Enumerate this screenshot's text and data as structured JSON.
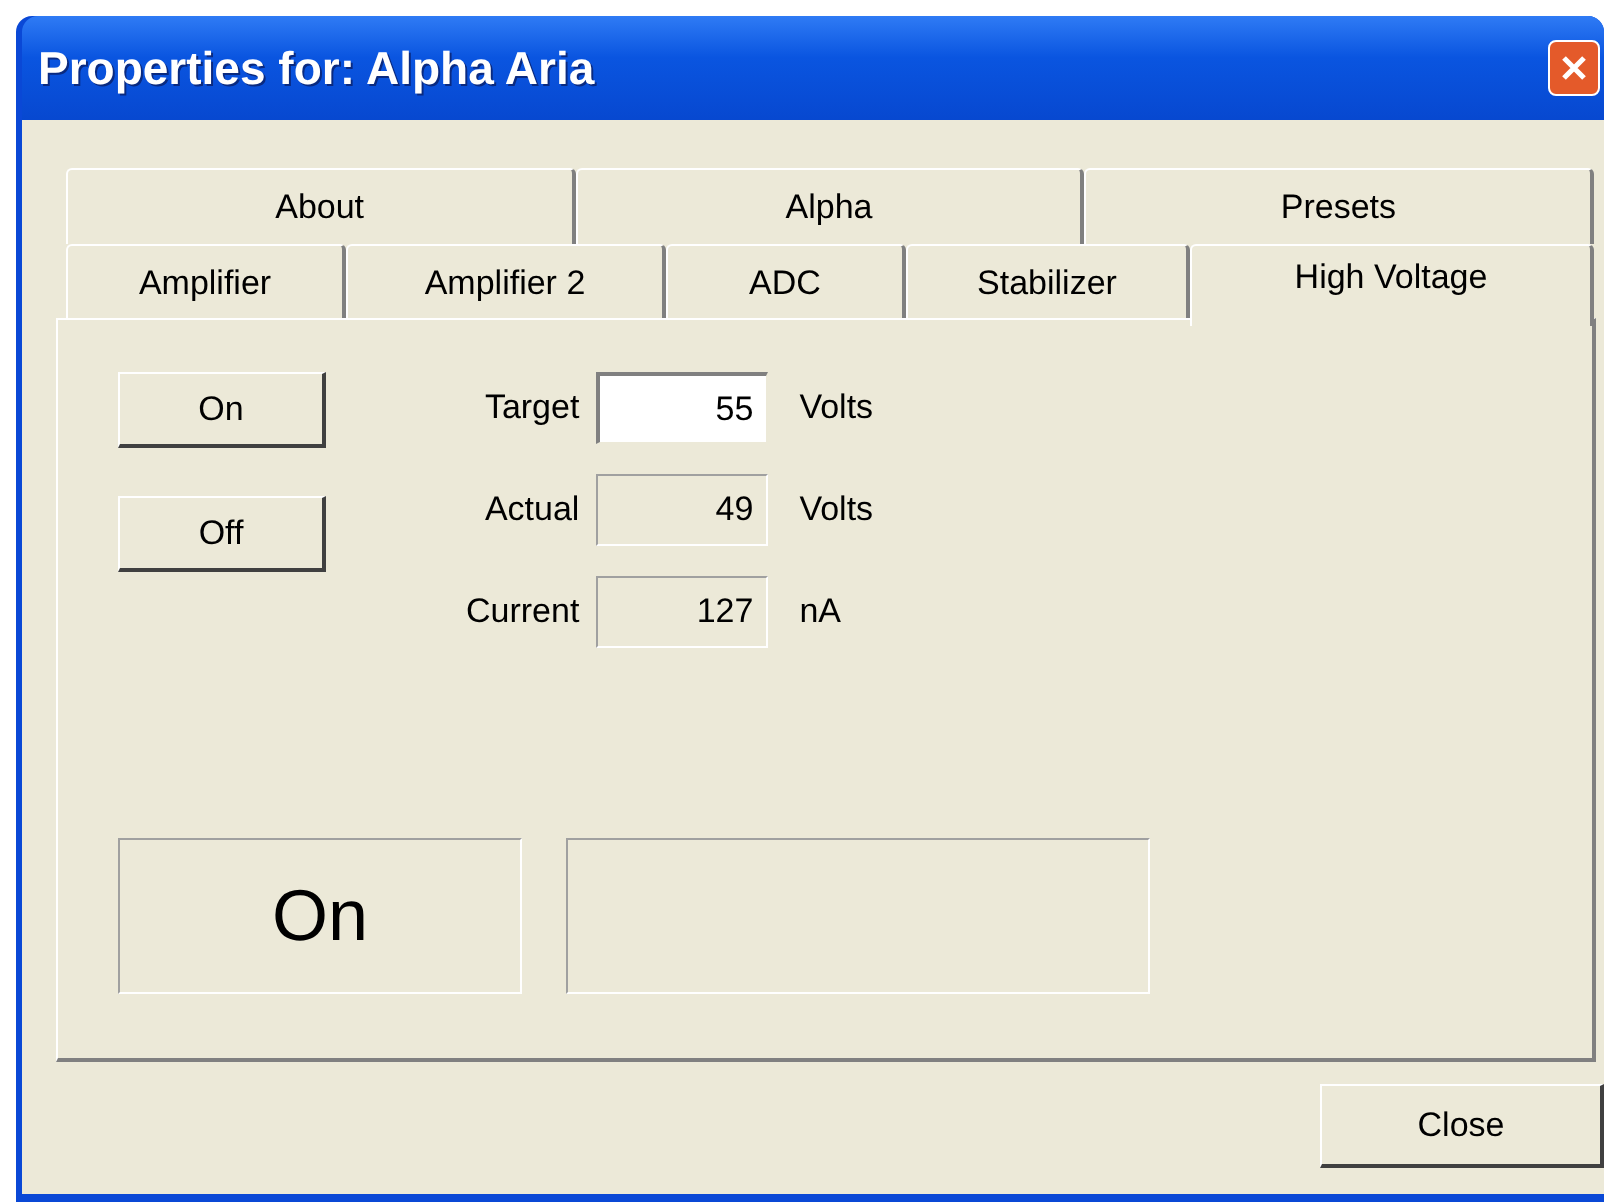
{
  "window": {
    "title": "Properties for: Alpha Aria"
  },
  "tab_rows": [
    {
      "tabs": [
        {
          "label": "About",
          "selected": false
        },
        {
          "label": "Alpha",
          "selected": false
        },
        {
          "label": "Presets",
          "selected": false
        }
      ]
    },
    {
      "tabs": [
        {
          "label": "Amplifier",
          "selected": false
        },
        {
          "label": "Amplifier 2",
          "selected": false
        },
        {
          "label": "ADC",
          "selected": false
        },
        {
          "label": "Stabilizer",
          "selected": false
        },
        {
          "label": "High Voltage",
          "selected": true
        }
      ]
    }
  ],
  "buttons": [
    "On",
    "Off"
  ],
  "readings": [
    {
      "label": "Target",
      "value": "55",
      "unit": "Volts",
      "kind": "input"
    },
    {
      "label": "Actual",
      "value": "49",
      "unit": "Volts",
      "kind": "readout"
    },
    {
      "label": "Current",
      "value": "127",
      "unit": "nA",
      "kind": "readout"
    }
  ],
  "status_panels": [
    {
      "kind": "text",
      "text": "On"
    },
    {
      "kind": "empty"
    }
  ],
  "footer_buttons": [
    "Close"
  ]
}
